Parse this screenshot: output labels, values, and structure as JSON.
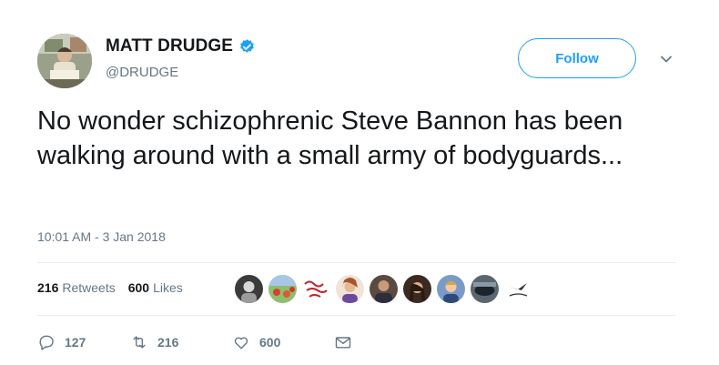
{
  "tweet": {
    "author": {
      "display_name": "MATT DRUDGE",
      "handle": "@DRUDGE",
      "verified": true
    },
    "follow_label": "Follow",
    "text": "No wonder schizophrenic Steve Bannon has been walking around with a small army of bodyguards...",
    "timestamp": "10:01 AM - 3 Jan 2018",
    "stats": {
      "retweets_count": "216",
      "retweets_label": "Retweets",
      "likes_count": "600",
      "likes_label": "Likes"
    },
    "liker_avatars": [
      "liker-1",
      "liker-2",
      "liker-3",
      "liker-4",
      "liker-5",
      "liker-6",
      "liker-7",
      "liker-8"
    ],
    "actions": {
      "replies": "127",
      "retweets": "216",
      "likes": "600"
    }
  },
  "colors": {
    "accent": "#1da1f2",
    "secondary_text": "#657786",
    "primary_text": "#14171a",
    "divider": "#e6ecf0"
  }
}
